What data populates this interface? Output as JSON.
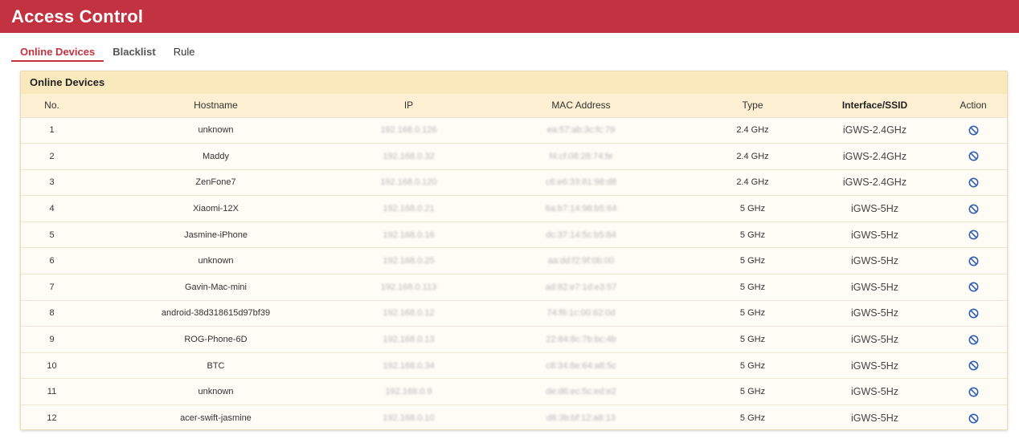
{
  "header": {
    "title": "Access Control"
  },
  "tabs": [
    {
      "label": "Online Devices"
    },
    {
      "label": "Blacklist"
    },
    {
      "label": "Rule"
    }
  ],
  "panel": {
    "title": "Online Devices"
  },
  "table": {
    "columns": [
      "No.",
      "Hostname",
      "IP",
      "MAC Address",
      "Type",
      "Interface/SSID",
      "Action"
    ],
    "rows": [
      {
        "no": "1",
        "hostname": "unknown",
        "ip": "192.168.0.126",
        "mac": "ea:57:ab:3c:fc:79",
        "type": "2.4 GHz",
        "ssid": "iGWS-2.4GHz"
      },
      {
        "no": "2",
        "hostname": "Maddy",
        "ip": "192.168.0.32",
        "mac": "f4:cf:08:28:74:fe",
        "type": "2.4 GHz",
        "ssid": "iGWS-2.4GHz"
      },
      {
        "no": "3",
        "hostname": "ZenFone7",
        "ip": "192.168.0.120",
        "mac": "c6:e6:33:81:98:d8",
        "type": "2.4 GHz",
        "ssid": "iGWS-2.4GHz"
      },
      {
        "no": "4",
        "hostname": "Xiaomi-12X",
        "ip": "192.168.0.21",
        "mac": "6a:b7:14:98:b5:64",
        "type": "5 GHz",
        "ssid": "iGWS-5Hz"
      },
      {
        "no": "5",
        "hostname": "Jasmine-iPhone",
        "ip": "192.168.0.16",
        "mac": "dc:37:14:5c:b5:84",
        "type": "5 GHz",
        "ssid": "iGWS-5Hz"
      },
      {
        "no": "6",
        "hostname": "unknown",
        "ip": "192.168.0.25",
        "mac": "aa:dd:f2:9f:0b:00",
        "type": "5 GHz",
        "ssid": "iGWS-5Hz"
      },
      {
        "no": "7",
        "hostname": "Gavin-Mac-mini",
        "ip": "192.168.0.113",
        "mac": "ad:82:e7:1d:e3:57",
        "type": "5 GHz",
        "ssid": "iGWS-5Hz"
      },
      {
        "no": "8",
        "hostname": "android-38d318615d97bf39",
        "ip": "192.168.0.12",
        "mac": "74:f6:1c:00:62:0d",
        "type": "5 GHz",
        "ssid": "iGWS-5Hz"
      },
      {
        "no": "9",
        "hostname": "ROG-Phone-6D",
        "ip": "192.168.0.13",
        "mac": "22:84:8c:7b:bc:4b",
        "type": "5 GHz",
        "ssid": "iGWS-5Hz"
      },
      {
        "no": "10",
        "hostname": "BTC",
        "ip": "192.168.0.34",
        "mac": "c8:34:8e:64:a8:5c",
        "type": "5 GHz",
        "ssid": "iGWS-5Hz"
      },
      {
        "no": "11",
        "hostname": "unknown",
        "ip": "192.168.0.9",
        "mac": "de:d6:ec:5c:ed:e2",
        "type": "5 GHz",
        "ssid": "iGWS-5Hz"
      },
      {
        "no": "12",
        "hostname": "acer-swift-jasmine",
        "ip": "192.168.0.10",
        "mac": "d6:3b:bf:12:a8:13",
        "type": "5 GHz",
        "ssid": "iGWS-5Hz"
      }
    ]
  },
  "icons": {
    "action": "block-icon"
  },
  "colors": {
    "brand": "#c23240",
    "panel_header": "#fbe9be",
    "action_icon": "#2f5fb5"
  }
}
